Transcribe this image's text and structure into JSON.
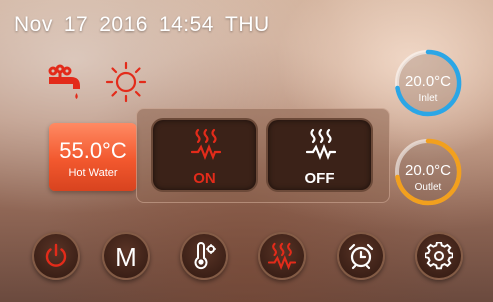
{
  "header": {
    "date_month": "Nov",
    "date_day": "17",
    "date_year": "2016",
    "time": "14:54",
    "weekday": "THU"
  },
  "hot_water": {
    "value": "55.0°C",
    "label": "Hot Water"
  },
  "heating": {
    "on_label": "ON",
    "off_label": "OFF"
  },
  "inlet": {
    "value": "20.0°C",
    "label": "Inlet"
  },
  "outlet": {
    "value": "20.0°C",
    "label": "Outlet"
  },
  "mode_button": {
    "label": "M"
  },
  "colors": {
    "red_accent": "#e32b1a",
    "inlet_ring": "#2ba6e6",
    "outlet_ring": "#f2a01e",
    "hot_water_tile": "#f2582e"
  },
  "icons": {
    "status": [
      "faucet-icon",
      "sun-icon"
    ],
    "bottom_bar": [
      "power-icon",
      "mode-icon",
      "thermometer-settings-icon",
      "heating-icon",
      "alarm-clock-icon",
      "settings-gear-icon"
    ]
  }
}
